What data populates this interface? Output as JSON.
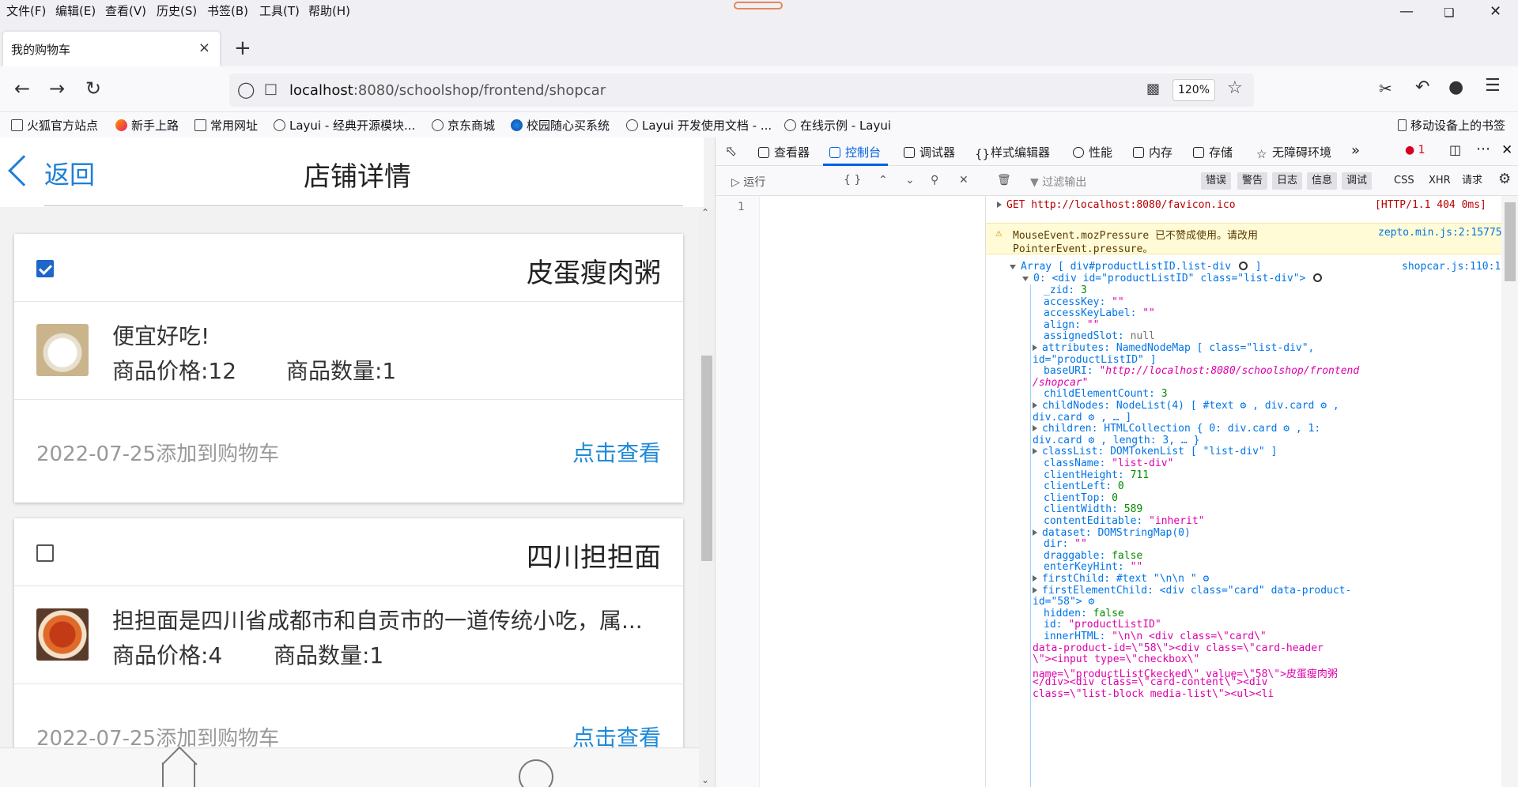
{
  "menu": [
    "文件(F)",
    "编辑(E)",
    "查看(V)",
    "历史(S)",
    "书签(B)",
    "工具(T)",
    "帮助(H)"
  ],
  "tab": {
    "title": "我的购物车",
    "close": "×",
    "new_tab": "+"
  },
  "nav": {
    "url_host": "localhost",
    "url_path": ":8080/schoolshop/frontend/shopcar",
    "zoom": "120%"
  },
  "bookmarks": [
    {
      "label": "火狐官方站点",
      "icon": "folder-icon"
    },
    {
      "label": "新手上路",
      "icon": "firefox-icon"
    },
    {
      "label": "常用网址",
      "icon": "folder-icon"
    },
    {
      "label": "Layui - 经典开源模块...",
      "icon": "globe-icon"
    },
    {
      "label": "京东商城",
      "icon": "globe-icon"
    },
    {
      "label": "校园随心买系统",
      "icon": "school-icon"
    },
    {
      "label": "Layui 开发使用文档 - ...",
      "icon": "globe-icon"
    },
    {
      "label": "在线示例 - Layui",
      "icon": "globe-icon"
    },
    {
      "label": "移动设备上的书签",
      "icon": "mobile-icon"
    }
  ],
  "page": {
    "back": "返回",
    "title": "店铺详情",
    "cards": [
      {
        "checked": true,
        "name": "皮蛋瘦肉粥",
        "desc": "便宜好吃!",
        "price": "商品价格:12",
        "qty": "商品数量:1",
        "date": "2022-07-25添加到购物车",
        "link": "点击查看"
      },
      {
        "checked": false,
        "name": "四川担担面",
        "desc": "担担面是四川省成都市和自贡市的一道传统小吃，属...",
        "price": "商品价格:4",
        "qty": "商品数量:1",
        "date": "2022-07-25添加到购物车",
        "link": "点击查看"
      }
    ]
  },
  "devtools": {
    "tabs": [
      "查看器",
      "控制台",
      "调试器",
      "样式编辑器",
      "性能",
      "内存",
      "存储",
      "无障碍环境"
    ],
    "selected_tab": "控制台",
    "error_count": "1",
    "run": "运行",
    "braces": "{ }",
    "filter_placeholder": "过滤输出",
    "filters": [
      "错误",
      "警告",
      "日志",
      "信息",
      "调试"
    ],
    "net_filters": [
      "CSS",
      "XHR",
      "请求"
    ],
    "line_number": "1",
    "console": {
      "get_line": "GET http://localhost:8080/favicon.ico",
      "get_status": "[HTTP/1.1 404",
      "get_time": "0ms]",
      "warn_line1": "MouseEvent.mozPressure 已不赞成使用。请改用",
      "warn_line2": "PointerEvent.pressure。",
      "warn_src": "zepto.min.js:2:15775",
      "array_head": "Array [ div#productListID.list-div",
      "array_src": "shopcar.js:110:17",
      "node_head": "0: <div id=\"productListID\" class=\"list-div\">",
      "props": [
        [
          "_zid: ",
          "3",
          "n"
        ],
        [
          "accessKey: ",
          "\"\"",
          "s"
        ],
        [
          "accessKeyLabel: ",
          "\"\"",
          "s"
        ],
        [
          "align: ",
          "\"\"",
          "s"
        ],
        [
          "assignedSlot: ",
          "null",
          "g"
        ],
        [
          "attributes: NamedNodeMap [ class=\"list-div\",",
          "",
          "t"
        ],
        [
          "id=\"productListID\" ]",
          "",
          "w"
        ],
        [
          "baseURI: ",
          "\"http://localhost:8080/schoolshop/frontend",
          "i"
        ],
        [
          "/shopcar\"",
          "",
          "iw"
        ],
        [
          "childElementCount: ",
          "3",
          "n"
        ],
        [
          "childNodes: NodeList(4) [ #text ⚙ , div.card ⚙ ,",
          "",
          "t"
        ],
        [
          "div.card ⚙ , … ]",
          "",
          "w"
        ],
        [
          "children: HTMLCollection { 0: div.card ⚙ , 1:",
          "",
          "t"
        ],
        [
          "div.card ⚙ , length: 3, … }",
          "",
          "w"
        ],
        [
          "classList: DOMTokenList [ \"list-div\" ]",
          "",
          "t"
        ],
        [
          "className: ",
          "\"list-div\"",
          "s"
        ],
        [
          "clientHeight: ",
          "711",
          "n"
        ],
        [
          "clientLeft: ",
          "0",
          "n"
        ],
        [
          "clientTop: ",
          "0",
          "n"
        ],
        [
          "clientWidth: ",
          "589",
          "n"
        ],
        [
          "contentEditable: ",
          "\"inherit\"",
          "s"
        ],
        [
          "dataset: DOMStringMap(0)",
          "",
          "t"
        ],
        [
          "dir: ",
          "\"\"",
          "s"
        ],
        [
          "draggable: ",
          "false",
          "n"
        ],
        [
          "enterKeyHint: ",
          "\"\"",
          "s"
        ],
        [
          "firstChild: #text \"\\n\\n            \" ⚙",
          "",
          "t"
        ],
        [
          "firstElementChild: <div class=\"card\" data-product-",
          "",
          "t"
        ],
        [
          "id=\"58\"> ⚙",
          "",
          "w"
        ],
        [
          "hidden: ",
          "false",
          "n"
        ],
        [
          "id: ",
          "\"productListID\"",
          "s"
        ],
        [
          "innerHTML: ",
          "\"\\n\\n            <div class=\\\"card\\\"",
          "s"
        ],
        [
          "data-product-id=\\\"58\\\"><div class=\\\"card-header",
          "",
          "sw"
        ],
        [
          "\\\"><input type=\\\"checkbox\\\"",
          "",
          "sw"
        ],
        [
          "name=\\\"productListCkecked\\\" value=\\\"58\\\">皮蛋瘦肉粥",
          "",
          "sw"
        ],
        [
          "</div><div class=\\\"card-content\\\"><div",
          "",
          "sw"
        ],
        [
          "class=\\\"list-block media-list\\\"><ul><li",
          "",
          "sw"
        ]
      ]
    }
  }
}
